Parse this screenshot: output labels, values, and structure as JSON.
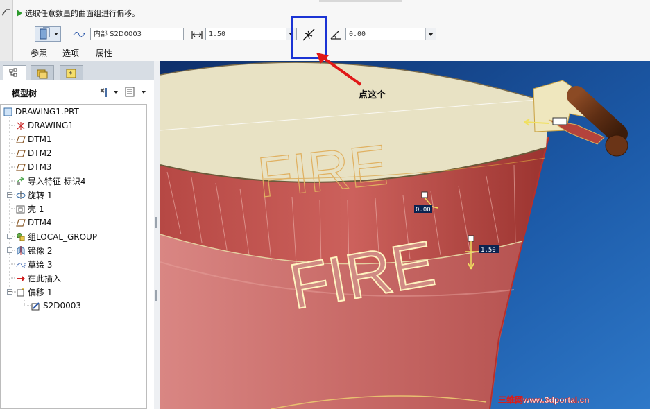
{
  "dashboard": {
    "message": "选取任意数量的曲面组进行偏移。",
    "reference_field_value": "内部  S2D0003",
    "offset_value": "1.50",
    "angle_value": "0.00",
    "tabs": [
      "参照",
      "选项",
      "属性"
    ]
  },
  "annotation": {
    "callout_text": "点这个"
  },
  "model_tree": {
    "title": "模型树",
    "items": [
      {
        "label": "DRAWING1.PRT",
        "icon": "part-icon"
      },
      {
        "label": "DRAWING1",
        "icon": "csys-icon"
      },
      {
        "label": "DTM1",
        "icon": "datum-plane-icon"
      },
      {
        "label": "DTM2",
        "icon": "datum-plane-icon"
      },
      {
        "label": "DTM3",
        "icon": "datum-plane-icon"
      },
      {
        "label": "导入特征 标识4",
        "icon": "import-feature-icon"
      },
      {
        "label": "旋转 1",
        "icon": "revolve-icon"
      },
      {
        "label": "壳 1",
        "icon": "shell-icon"
      },
      {
        "label": "DTM4",
        "icon": "datum-plane-icon"
      },
      {
        "label": "组LOCAL_GROUP",
        "icon": "group-icon"
      },
      {
        "label": "镜像 2",
        "icon": "mirror-icon"
      },
      {
        "label": "草绘 3",
        "icon": "sketch-icon"
      },
      {
        "label": "在此插入",
        "icon": "insert-here-arrow-icon"
      },
      {
        "label": "偏移 1",
        "icon": "offset-icon"
      },
      {
        "label": "S2D0003",
        "icon": "sketch-section-icon"
      }
    ]
  },
  "graphics": {
    "model_text": "FIRE",
    "dim_angle": "0.00",
    "dim_offset": "1.50",
    "watermark": "三维网www.3dportal.cn"
  },
  "colors": {
    "highlight_box": "#1b34d4",
    "callout_arrow": "#e01818",
    "viewport_bg": "#143a78",
    "bucket_red": "#c9605e"
  }
}
